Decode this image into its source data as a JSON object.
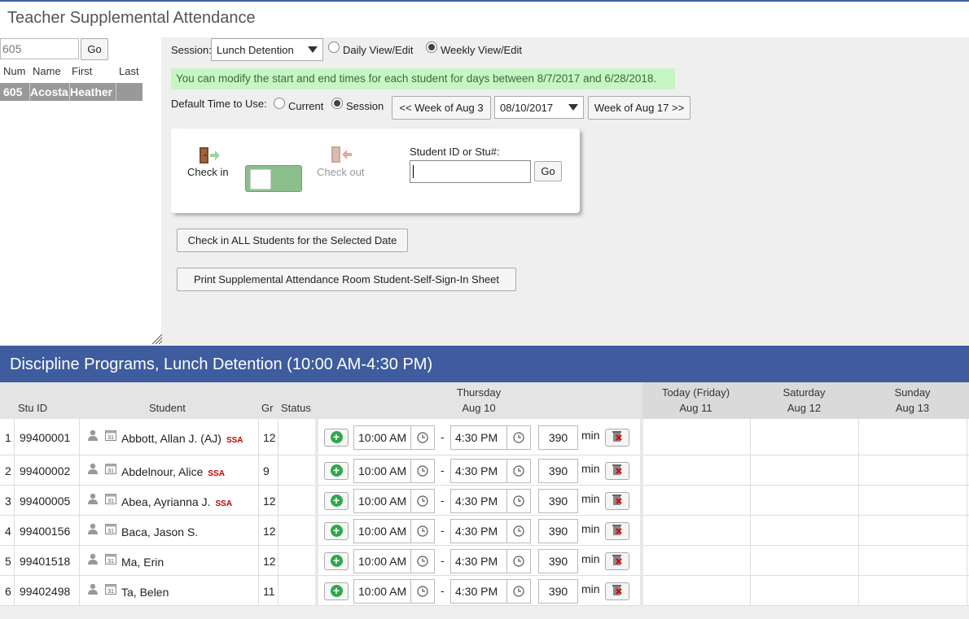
{
  "page": {
    "title": "Teacher Supplemental Attendance"
  },
  "teacher_search": {
    "value": "605",
    "go_label": "Go"
  },
  "teacher_list": {
    "headers": [
      "Num",
      "Name",
      "First",
      "Last"
    ],
    "rows": [
      {
        "num": "605",
        "name": "Acosta",
        "first": "Heather",
        "last": ""
      }
    ]
  },
  "session": {
    "label": "Session:",
    "selected": "Lunch Detention",
    "views": [
      {
        "label": "Daily View/Edit",
        "checked": false
      },
      {
        "label": "Weekly View/Edit",
        "checked": true
      }
    ]
  },
  "notice": "You can modify the start and end times for each student for days between 8/7/2017 and 6/28/2018.",
  "time_default": {
    "label": "Default Time to Use:",
    "options": [
      {
        "label": "Current",
        "checked": false
      },
      {
        "label": "Session",
        "checked": true
      }
    ]
  },
  "week_nav": {
    "prev_label": "<< Week of Aug 3",
    "date": "08/10/2017",
    "next_label": "Week of Aug 17 >>"
  },
  "checkin_panel": {
    "checkin_label": "Check in",
    "checkout_label": "Check out",
    "student_id_label": "Student ID or Stu#:",
    "student_id_value": "",
    "go_label": "Go"
  },
  "actions": {
    "checkin_all": "Check in ALL Students for the Selected Date",
    "print_sheet": "Print Supplemental Attendance Room Student-Self-Sign-In Sheet"
  },
  "program": {
    "title": "Discipline Programs, Lunch Detention (10:00 AM-4:30 PM)"
  },
  "table": {
    "headers": {
      "stu_id": "Stu ID",
      "student": "Student",
      "gr": "Gr",
      "status": "Status"
    },
    "days": [
      {
        "name": "Thursday",
        "date": "Aug 10"
      },
      {
        "name": "Today (Friday)",
        "date": "Aug 11"
      },
      {
        "name": "Saturday",
        "date": "Aug 12"
      },
      {
        "name": "Sunday",
        "date": "Aug 13"
      }
    ],
    "min_label": "min",
    "rows": [
      {
        "n": "1",
        "id": "99400001",
        "name": "Abbott, Allan J. (AJ)",
        "ssa": "SSA",
        "gr": "12",
        "start": "10:00 AM",
        "end": "4:30 PM",
        "mins": "390"
      },
      {
        "n": "2",
        "id": "99400002",
        "name": "Abdelnour, Alice",
        "ssa": "SSA",
        "gr": "9",
        "start": "10:00 AM",
        "end": "4:30 PM",
        "mins": "390"
      },
      {
        "n": "3",
        "id": "99400005",
        "name": "Abea, Ayrianna J.",
        "ssa": "SSA",
        "gr": "12",
        "start": "10:00 AM",
        "end": "4:30 PM",
        "mins": "390"
      },
      {
        "n": "4",
        "id": "99400156",
        "name": "Baca, Jason S.",
        "ssa": "",
        "gr": "12",
        "start": "10:00 AM",
        "end": "4:30 PM",
        "mins": "390"
      },
      {
        "n": "5",
        "id": "99401518",
        "name": "Ma, Erin",
        "ssa": "",
        "gr": "12",
        "start": "10:00 AM",
        "end": "4:30 PM",
        "mins": "390"
      },
      {
        "n": "6",
        "id": "99402498",
        "name": "Ta, Belen",
        "ssa": "",
        "gr": "11",
        "start": "10:00 AM",
        "end": "4:30 PM",
        "mins": "390"
      }
    ]
  },
  "icons": {
    "door_in": "door-enter-icon",
    "door_out": "door-exit-icon",
    "person": "person-icon",
    "calendar": "calendar-icon",
    "add": "plus-circle-icon",
    "clock": "clock-icon",
    "delete": "trash-x-icon",
    "dropdown": "chevron-down-icon"
  },
  "colors": {
    "header_blue": "#3e5c9e",
    "notice_bg": "#c7f5c4",
    "ssa_red": "#c00000",
    "toggle_green": "#8dbf8d",
    "add_green": "#2ea84a"
  }
}
